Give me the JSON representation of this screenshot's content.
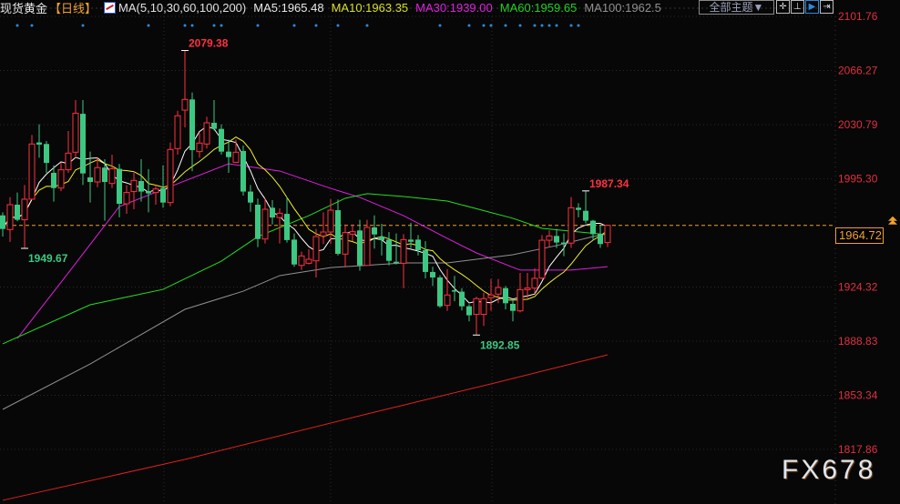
{
  "header": {
    "title": "现货黄金",
    "period": "【日线】",
    "ma_label": "MA(5,10,30,60,100,200)",
    "ma5": "MA5:1965.48",
    "ma10": "MA10:1963.35",
    "ma30": "MA30:1939.00",
    "ma60": "MA60:1959.65",
    "ma100": "MA100:1962.5"
  },
  "toolbar": {
    "theme_dropdown": "全部主题▼",
    "buttons": [
      {
        "name": "crosshair",
        "glyph": "✛"
      },
      {
        "name": "axis",
        "glyph": "⊥"
      },
      {
        "name": "play",
        "glyph": "▶"
      },
      {
        "name": "shift-right",
        "glyph": "⇥"
      }
    ]
  },
  "watermark": "FX678",
  "current_price": "1964.72",
  "colors": {
    "up": "#ff3040",
    "down": "#3cc882",
    "ma5": "#ffffff",
    "ma10": "#f0f020",
    "ma30": "#e020e0",
    "ma60": "#20e020",
    "ma100": "#909090",
    "ma200": "#e02020",
    "axis_text": "#e03040",
    "current": "#f0a030",
    "marker": "#2a8ae0"
  },
  "chart_data": {
    "type": "candlestick",
    "title": "现货黄金【日线】",
    "ylim": [
      1817.86,
      2101.76
    ],
    "yticks": [
      "2101.76",
      "2066.27",
      "2030.79",
      "1995.30",
      "1924.32",
      "1888.83",
      "1853.34",
      "1817.86"
    ],
    "grid": true,
    "candles_ohlc": [
      [
        1971.3,
        1973.3,
        1957.4,
        1962.4
      ],
      [
        1962.0,
        1983.3,
        1953.9,
        1978.3
      ],
      [
        1978.3,
        1986.3,
        1967.4,
        1968.4
      ],
      [
        1968.4,
        1991.2,
        1949.67,
        1981.9
      ],
      [
        1981.9,
        2024.0,
        1981.3,
        2018.1
      ],
      [
        2019.1,
        2031.0,
        2009.1,
        2017.7
      ],
      [
        2018.1,
        2020.0,
        1999.2,
        2005.7
      ],
      [
        1999.2,
        2004.1,
        1980.3,
        1989.2
      ],
      [
        1989.2,
        2006.1,
        1987.2,
        2001.2
      ],
      [
        2001.2,
        2026.6,
        1999.2,
        2012.1
      ],
      [
        2012.7,
        2046.9,
        2009.1,
        2038.3
      ],
      [
        2037.9,
        2046.9,
        1991.2,
        1998.8
      ],
      [
        1996.2,
        2013.1,
        1979.7,
        1993.2
      ],
      [
        1993.2,
        2009.1,
        1989.8,
        2002.6
      ],
      [
        2002.6,
        2008.1,
        1967.8,
        1993.2
      ],
      [
        1992.2,
        2011.1,
        1989.2,
        2001.8
      ],
      [
        2001.8,
        2005.1,
        1970.0,
        1978.9
      ],
      [
        1978.9,
        1991.2,
        1972.3,
        1986.3
      ],
      [
        1986.9,
        1999.2,
        1975.3,
        1994.2
      ],
      [
        1993.8,
        2008.1,
        1980.3,
        1986.9
      ],
      [
        1987.2,
        2001.6,
        1973.3,
        1985.7
      ],
      [
        1986.3,
        1991.2,
        1978.3,
        1988.6
      ],
      [
        1989.2,
        2004.1,
        1976.3,
        1979.7
      ],
      [
        1979.7,
        2019.1,
        1977.3,
        2014.5
      ],
      [
        2015.1,
        2039.9,
        2011.1,
        2036.6
      ],
      [
        2040.3,
        2079.38,
        2029.0,
        2047.3
      ],
      [
        2047.3,
        2051.9,
        2000.2,
        2014.1
      ],
      [
        2013.1,
        2025.0,
        2009.1,
        2018.7
      ],
      [
        2018.1,
        2036.0,
        2015.1,
        2032.0
      ],
      [
        2032.0,
        2046.9,
        2027.0,
        2028.0
      ],
      [
        2028.0,
        2031.0,
        2011.1,
        2013.1
      ],
      [
        2013.1,
        2021.0,
        1999.2,
        2009.5
      ],
      [
        2006.1,
        2021.0,
        2006.1,
        2012.7
      ],
      [
        2013.5,
        2017.1,
        1984.3,
        1986.9
      ],
      [
        1986.9,
        1991.2,
        1973.7,
        1979.7
      ],
      [
        1978.3,
        1982.3,
        1950.5,
        1955.8
      ],
      [
        1955.8,
        1982.3,
        1952.9,
        1975.3
      ],
      [
        1976.3,
        1981.3,
        1965.4,
        1969.9
      ],
      [
        1969.9,
        1975.9,
        1952.9,
        1972.7
      ],
      [
        1972.3,
        1983.3,
        1953.5,
        1955.1
      ],
      [
        1955.4,
        1959.4,
        1937.6,
        1939.1
      ],
      [
        1938.5,
        1947.5,
        1935.6,
        1944.7
      ],
      [
        1939.9,
        1949.1,
        1939.1,
        1942.5
      ],
      [
        1941.5,
        1962.4,
        1930.6,
        1957.4
      ],
      [
        1957.8,
        1973.3,
        1952.5,
        1960.4
      ],
      [
        1960.4,
        1981.9,
        1952.5,
        1974.7
      ],
      [
        1974.7,
        1981.7,
        1945.0,
        1946.1
      ],
      [
        1945.9,
        1965.4,
        1937.2,
        1960.0
      ],
      [
        1959.0,
        1965.4,
        1954.4,
        1960.6
      ],
      [
        1961.4,
        1968.4,
        1935.0,
        1938.5
      ],
      [
        1938.5,
        1968.4,
        1938.5,
        1963.4
      ],
      [
        1963.4,
        1971.3,
        1949.5,
        1958.8
      ],
      [
        1957.4,
        1965.8,
        1945.0,
        1955.0
      ],
      [
        1955.4,
        1960.4,
        1938.5,
        1941.5
      ],
      [
        1940.9,
        1959.4,
        1939.1,
        1939.9
      ],
      [
        1939.9,
        1959.0,
        1923.6,
        1955.4
      ],
      [
        1955.4,
        1966.4,
        1950.0,
        1954.0
      ],
      [
        1955.4,
        1958.4,
        1945.0,
        1948.5
      ],
      [
        1948.5,
        1954.4,
        1930.0,
        1934.2
      ],
      [
        1934.2,
        1937.6,
        1925.0,
        1930.6
      ],
      [
        1930.6,
        1932.0,
        1910.7,
        1911.7
      ],
      [
        1912.3,
        1936.0,
        1908.7,
        1919.1
      ],
      [
        1922.2,
        1931.6,
        1915.0,
        1921.3
      ],
      [
        1921.3,
        1923.6,
        1909.0,
        1911.7
      ],
      [
        1911.7,
        1913.0,
        1901.8,
        1905.8
      ],
      [
        1906.4,
        1918.0,
        1892.85,
        1916.7
      ],
      [
        1906.4,
        1920.6,
        1898.8,
        1916.7
      ],
      [
        1917.3,
        1929.6,
        1908.7,
        1919.1
      ],
      [
        1919.7,
        1929.6,
        1913.7,
        1924.0
      ],
      [
        1923.6,
        1925.0,
        1909.7,
        1913.7
      ],
      [
        1913.3,
        1916.0,
        1901.8,
        1908.7
      ],
      [
        1908.7,
        1933.6,
        1907.7,
        1922.6
      ],
      [
        1922.6,
        1933.6,
        1917.0,
        1923.6
      ],
      [
        1923.6,
        1936.6,
        1920.0,
        1930.0
      ],
      [
        1930.2,
        1958.4,
        1929.6,
        1955.0
      ],
      [
        1955.0,
        1961.4,
        1950.5,
        1957.8
      ],
      [
        1957.8,
        1962.4,
        1949.9,
        1953.5
      ],
      [
        1953.5,
        1959.4,
        1944.5,
        1952.5
      ],
      [
        1953.1,
        1983.3,
        1950.0,
        1976.3
      ],
      [
        1976.3,
        1979.3,
        1970.0,
        1974.9
      ],
      [
        1974.3,
        1987.34,
        1966.0,
        1967.8
      ],
      [
        1967.8,
        1968.4,
        1955.0,
        1959.0
      ],
      [
        1959.0,
        1965.4,
        1950.0,
        1952.5
      ],
      [
        1953.5,
        1964.4,
        1950.5,
        1964.72
      ]
    ],
    "ma_series": [
      {
        "name": "MA30",
        "color_key": "ma30",
        "points": [
          [
            2,
            1890.6
          ],
          [
            9,
            1933.6
          ],
          [
            16,
            1977.1
          ],
          [
            23,
            1990.2
          ],
          [
            31,
            2005.1
          ],
          [
            38,
            2000.4
          ],
          [
            45,
            1989.0
          ],
          [
            49,
            1983.1
          ],
          [
            55,
            1971.1
          ],
          [
            61,
            1956.2
          ],
          [
            65,
            1946.7
          ],
          [
            71,
            1935.4
          ],
          [
            78,
            1935.4
          ],
          [
            83,
            1937.7
          ]
        ]
      },
      {
        "name": "MA60",
        "color_key": "ma60",
        "points": [
          [
            0,
            1887.1
          ],
          [
            12,
            1912.7
          ],
          [
            22,
            1922.8
          ],
          [
            30,
            1941.3
          ],
          [
            35,
            1957.4
          ],
          [
            42,
            1971.1
          ],
          [
            47,
            1982.5
          ],
          [
            50,
            1985.5
          ],
          [
            55,
            1983.7
          ],
          [
            61,
            1980.7
          ],
          [
            70,
            1969.4
          ],
          [
            74,
            1962.8
          ],
          [
            83,
            1958.6
          ]
        ]
      },
      {
        "name": "MA100",
        "color_key": "ma100",
        "points": [
          [
            0,
            1844.1
          ],
          [
            12,
            1873.9
          ],
          [
            25,
            1909.7
          ],
          [
            33,
            1921.6
          ],
          [
            38,
            1931.8
          ],
          [
            45,
            1937.1
          ],
          [
            49,
            1938.3
          ],
          [
            55,
            1940.1
          ],
          [
            61,
            1940.1
          ],
          [
            65,
            1942.5
          ],
          [
            70,
            1945.5
          ],
          [
            76,
            1951.5
          ],
          [
            81,
            1957.4
          ],
          [
            83,
            1959.2
          ]
        ]
      },
      {
        "name": "MA200",
        "color_key": "ma200",
        "points": [
          [
            0,
            1784.5
          ],
          [
            25,
            1811.3
          ],
          [
            50,
            1841.1
          ],
          [
            68,
            1862.0
          ],
          [
            83,
            1879.9
          ]
        ]
      }
    ],
    "annotations": [
      {
        "index": 25,
        "text": "2079.38",
        "type": "high"
      },
      {
        "index": 3,
        "text": "1949.67",
        "type": "low"
      },
      {
        "index": 65,
        "text": "1892.85",
        "type": "low"
      },
      {
        "index": 80,
        "text": "1987.34",
        "type": "high"
      }
    ],
    "event_marker_indices": [
      2,
      4,
      11,
      20,
      25,
      26,
      29,
      30,
      35,
      40,
      43,
      46,
      50,
      60,
      64,
      66,
      67,
      69,
      71,
      73,
      74,
      75,
      76,
      78,
      79
    ]
  }
}
